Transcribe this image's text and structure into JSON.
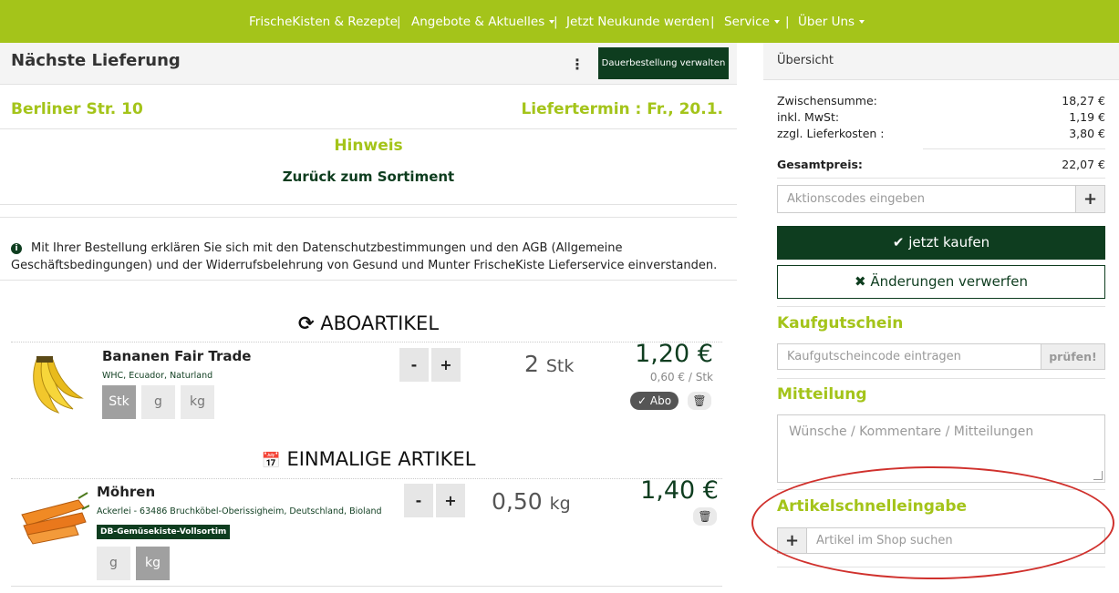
{
  "nav": {
    "items": [
      "FrischeKisten & Rezepte",
      "Angebote & Aktuelles",
      "Jetzt Neukunde werden",
      "Service",
      "Über Uns"
    ],
    "sep": "|"
  },
  "header": {
    "title": "Nächste Lieferung",
    "kebab": "⋮",
    "manage_button": "Dauerbestellung verwalten"
  },
  "delivery": {
    "address": "Berliner Str. 10",
    "date": "Liefertermin : Fr., 20.1.",
    "hint_title": "Hinweis",
    "back_link": "Zurück zum Sortiment",
    "info_icon": "i",
    "notice": "Mit Ihrer Bestellung erklären Sie sich mit den Datenschutzbestimmungen und den AGB (Allgemeine Geschäftsbedingungen) und der Widerrufsbelehrung von Gesund und Munter FrischeKiste Lieferservice einverstanden."
  },
  "sections": {
    "abo_icon": "⟳",
    "abo_title": "ABOARTIKEL",
    "once_icon": "📅",
    "once_title": "EINMALIGE ARTIKEL"
  },
  "products": {
    "bananen": {
      "name": "Bananen Fair Trade",
      "origin": "WHC, Ecuador, Naturland",
      "units": [
        "Stk",
        "g",
        "kg"
      ],
      "selected_unit": "Stk",
      "minus": "-",
      "plus": "+",
      "qty": "2",
      "qty_unit": "Stk",
      "price": "1,20 €",
      "unit_price": "0,60 € / Stk",
      "abo_icon": "✓",
      "abo_label": "Abo",
      "trash_icon": "🗑"
    },
    "moehren": {
      "name": "Möhren",
      "origin": "Ackerlei - 63486 Bruchköbel-Oberissigheim, Deutschland, Bioland",
      "tag": "DB-Gemüsekiste-Vollsortim",
      "units": [
        "g",
        "kg"
      ],
      "selected_unit": "kg",
      "minus": "-",
      "plus": "+",
      "qty": "0,50",
      "qty_unit": "kg",
      "price": "1,40 €",
      "trash_icon": "🗑"
    }
  },
  "summary": {
    "title": "Übersicht",
    "subtotal_label": "Zwischensumme:",
    "subtotal": "18,27 €",
    "vat_label": "inkl. MwSt:",
    "vat": "1,19 €",
    "shipping_label": "zzgl. Lieferkosten :",
    "shipping": "3,80 €",
    "total_label": "Gesamtpreis:",
    "total": "22,07 €",
    "promo_placeholder": "Aktionscodes eingeben",
    "promo_add": "+",
    "buy_icon": "✔",
    "buy_label": "jetzt kaufen",
    "discard_icon": "✖",
    "discard_label": "Änderungen verwerfen",
    "voucher_title": "Kaufgutschein",
    "voucher_placeholder": "Kaufgutscheincode eintragen",
    "voucher_check": "prüfen!",
    "message_title": "Mitteilung",
    "message_placeholder": "Wünsche / Kommentare / Mitteilungen",
    "quick_title": "Artikelschnelleingabe",
    "quick_add": "+",
    "quick_placeholder": "Artikel im Shop suchen"
  },
  "colors": {
    "brand_green": "#a4c41a",
    "dark_green": "#0e3d1f",
    "highlight_red": "#d0312d"
  }
}
